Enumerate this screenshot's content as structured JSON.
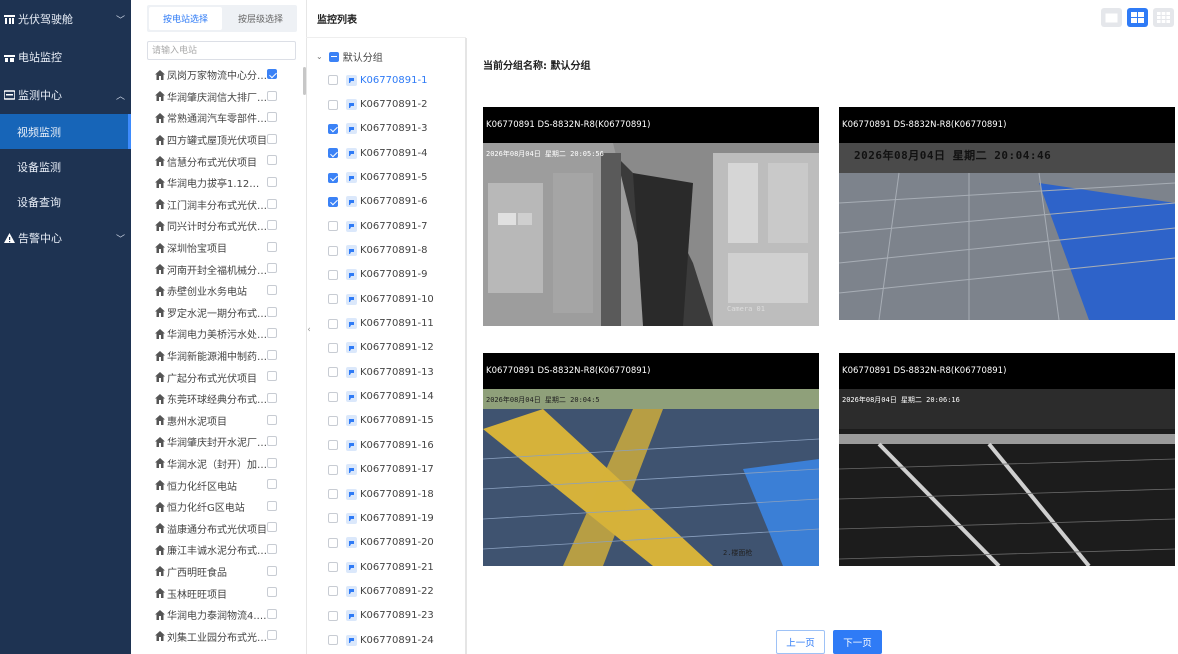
{
  "sidebar": {
    "items": [
      {
        "label": "光伏驾驶舱",
        "icon": "dashboard-icon",
        "expanded": false
      },
      {
        "label": "电站监控",
        "icon": "building-icon"
      },
      {
        "label": "监测中心",
        "icon": "monitor-icon",
        "expanded": true,
        "children": [
          {
            "label": "视频监测",
            "active": true
          },
          {
            "label": "设备监测"
          },
          {
            "label": "设备查询"
          }
        ]
      },
      {
        "label": "告警中心",
        "icon": "warning-icon",
        "expanded": false
      }
    ]
  },
  "station_panel": {
    "tabs": [
      {
        "label": "按电站选择",
        "active": true
      },
      {
        "label": "按层级选择",
        "active": false
      }
    ],
    "search_placeholder": "请输入电站",
    "stations": [
      {
        "name": "凤岗万家物流中心分布...",
        "checked": true
      },
      {
        "name": "华润肇庆润信大排厂区...",
        "checked": false
      },
      {
        "name": "常熟通润汽车零部件股...",
        "checked": false
      },
      {
        "name": "四方罐式屋顶光伏项目",
        "checked": false
      },
      {
        "name": "信慧分布式光伏项目",
        "checked": false
      },
      {
        "name": "华润电力拔亭1.12MW...",
        "checked": false
      },
      {
        "name": "江门润丰分布式光伏项目",
        "checked": false
      },
      {
        "name": "同兴计时分布式光伏项目",
        "checked": false
      },
      {
        "name": "深圳怡宝项目",
        "checked": false
      },
      {
        "name": "河南开封全福机械分布...",
        "checked": false
      },
      {
        "name": "赤壁创业水务电站",
        "checked": false
      },
      {
        "name": "罗定水泥一期分布式光...",
        "checked": false
      },
      {
        "name": "华润电力美桥污水处理...",
        "checked": false
      },
      {
        "name": "华润新能源湘中制药2.2...",
        "checked": false
      },
      {
        "name": "广起分布式光伏项目",
        "checked": false
      },
      {
        "name": "东莞环球经典分布式光...",
        "checked": false
      },
      {
        "name": "惠州水泥项目",
        "checked": false
      },
      {
        "name": "华润肇庆封开水泥厂区...",
        "checked": false
      },
      {
        "name": "华润水泥（封开）加气...",
        "checked": false
      },
      {
        "name": "恒力化纤区电站",
        "checked": false
      },
      {
        "name": "恒力化纤G区电站",
        "checked": false
      },
      {
        "name": "溢康通分布式光伏项目",
        "checked": false
      },
      {
        "name": "廉江丰诚水泥分布式光...",
        "checked": false
      },
      {
        "name": "广西明旺食品",
        "checked": false
      },
      {
        "name": "玉林旺旺项目",
        "checked": false
      },
      {
        "name": "华润电力泰润物流4.8W...",
        "checked": false
      },
      {
        "name": "刘集工业园分布式光伏...",
        "checked": false
      }
    ]
  },
  "monitor_tree": {
    "title": "监控列表",
    "root_label": "默认分组",
    "nodes": [
      {
        "label": "K06770891-1",
        "checked": false,
        "selected": true
      },
      {
        "label": "K06770891-2",
        "checked": false
      },
      {
        "label": "K06770891-3",
        "checked": true
      },
      {
        "label": "K06770891-4",
        "checked": true
      },
      {
        "label": "K06770891-5",
        "checked": true
      },
      {
        "label": "K06770891-6",
        "checked": true
      },
      {
        "label": "K06770891-7",
        "checked": false
      },
      {
        "label": "K06770891-8",
        "checked": false
      },
      {
        "label": "K06770891-9",
        "checked": false
      },
      {
        "label": "K06770891-10",
        "checked": false
      },
      {
        "label": "K06770891-11",
        "checked": false
      },
      {
        "label": "K06770891-12",
        "checked": false
      },
      {
        "label": "K06770891-13",
        "checked": false
      },
      {
        "label": "K06770891-14",
        "checked": false
      },
      {
        "label": "K06770891-15",
        "checked": false
      },
      {
        "label": "K06770891-16",
        "checked": false
      },
      {
        "label": "K06770891-17",
        "checked": false
      },
      {
        "label": "K06770891-18",
        "checked": false
      },
      {
        "label": "K06770891-19",
        "checked": false
      },
      {
        "label": "K06770891-20",
        "checked": false
      },
      {
        "label": "K06770891-21",
        "checked": false
      },
      {
        "label": "K06770891-22",
        "checked": false
      },
      {
        "label": "K06770891-23",
        "checked": false
      },
      {
        "label": "K06770891-24",
        "checked": false
      }
    ]
  },
  "main": {
    "group_label": "当前分组名称: 默认分组",
    "view_modes": [
      "single-view-icon",
      "quad-view-icon",
      "nine-view-icon"
    ],
    "active_view": "quad-view-icon",
    "videos": [
      {
        "title": "K06770891  DS-8832N-R8(K06770891)",
        "osd": "2026年08月04日  星期二  20:05:56",
        "corner": "Camera 01"
      },
      {
        "title": "K06770891  DS-8832N-R8(K06770891)",
        "osd": "2026年08月04日  星期二  20:04:46",
        "corner": ""
      },
      {
        "title": "K06770891  DS-8832N-R8(K06770891)",
        "osd": "2026年08月04日  星期二  20:04:5",
        "corner": "2.楼面枪"
      },
      {
        "title": "K06770891  DS-8832N-R8(K06770891)",
        "osd": "2026年08月04日  星期二  20:06:16",
        "corner": ""
      }
    ],
    "pagination": {
      "prev": "上一页",
      "next": "下一页"
    }
  },
  "colors": {
    "sidebar_bg": "#1e3352",
    "active_nav": "#1765b8",
    "accent": "#2f7bf6"
  }
}
